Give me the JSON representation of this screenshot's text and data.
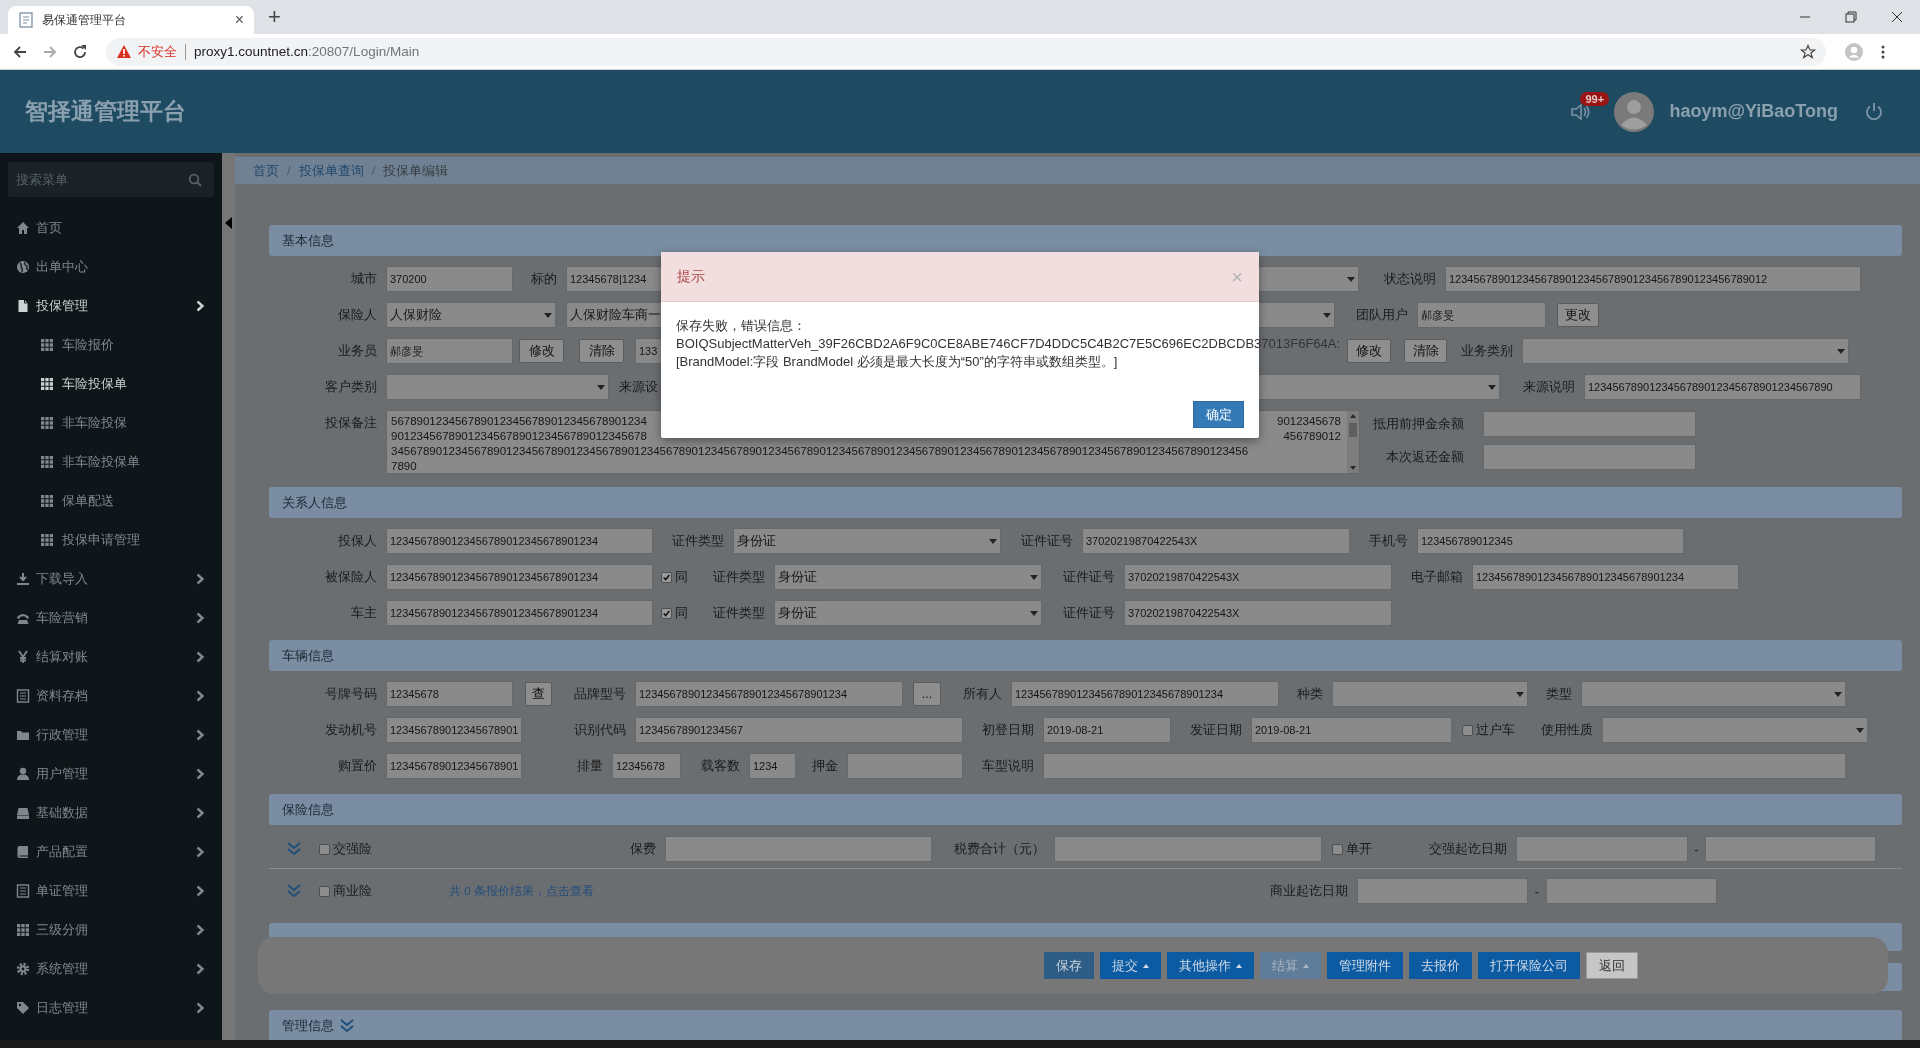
{
  "browser": {
    "tab_title": "易保通管理平台",
    "tab_close": "×",
    "new_tab": "+",
    "security": "不安全",
    "url_host": "proxy1.countnet.cn",
    "url_path": ":20807/Login/Main"
  },
  "header": {
    "title": "智择通管理平台",
    "badge": "99+",
    "user": "haoym@YiBaoTong"
  },
  "sidebar": {
    "search": {
      "placeholder": "搜索菜单"
    },
    "items": [
      {
        "label": "首页",
        "kind": "link",
        "selected": false
      },
      {
        "label": "出单中心",
        "kind": "link",
        "selected": false
      },
      {
        "label": "投保管理",
        "kind": "group",
        "selected": false,
        "expanded": true,
        "children": [
          {
            "label": "车险报价",
            "selected": false
          },
          {
            "label": "车险投保单",
            "selected": true
          },
          {
            "label": "非车险投保",
            "selected": false
          },
          {
            "label": "非车险投保单",
            "selected": false
          },
          {
            "label": "保单配送",
            "selected": false
          },
          {
            "label": "投保申请管理",
            "selected": false
          }
        ]
      },
      {
        "label": "下载导入",
        "kind": "group",
        "selected": false,
        "expanded": false
      },
      {
        "label": "车险营销",
        "kind": "group",
        "selected": false,
        "expanded": false
      },
      {
        "label": "结算对账",
        "kind": "group",
        "selected": false,
        "expanded": false
      },
      {
        "label": "资料存档",
        "kind": "group",
        "selected": false,
        "expanded": false
      },
      {
        "label": "行政管理",
        "kind": "group",
        "selected": false,
        "expanded": false
      },
      {
        "label": "用户管理",
        "kind": "group",
        "selected": false,
        "expanded": false
      },
      {
        "label": "基础数据",
        "kind": "group",
        "selected": false,
        "expanded": false
      },
      {
        "label": "产品配置",
        "kind": "group",
        "selected": false,
        "expanded": false
      },
      {
        "label": "单证管理",
        "kind": "group",
        "selected": false,
        "expanded": false
      },
      {
        "label": "三级分佣",
        "kind": "group",
        "selected": false,
        "expanded": false
      },
      {
        "label": "系统管理",
        "kind": "group",
        "selected": false,
        "expanded": false
      },
      {
        "label": "日志管理",
        "kind": "group",
        "selected": false,
        "expanded": false
      }
    ]
  },
  "breadcrumb": [
    {
      "kind": "link",
      "text": "首页"
    },
    {
      "kind": "separator",
      "text": "/"
    },
    {
      "kind": "link",
      "text": "投保单查询"
    },
    {
      "kind": "separator",
      "text": "/"
    },
    {
      "kind": "current",
      "text": "投保单编辑"
    }
  ],
  "sections": [
    {
      "kind": "form",
      "title": "基本信息",
      "rows": [
        {
          "kind": "fields",
          "items": [
            {
              "kind": "label",
              "text": "城市"
            },
            {
              "kind": "input",
              "value": "370200"
            },
            {
              "kind": "label",
              "text": "标的"
            },
            {
              "kind": "input",
              "value": "12345678|1234"
            },
            {
              "kind": "select"
            },
            {
              "kind": "label",
              "text": "状态说明"
            },
            {
              "kind": "input",
              "value": "1234567890123456789012345678901234567890123456789012"
            }
          ]
        },
        {
          "kind": "fields",
          "items": [
            {
              "kind": "label",
              "text": "保险人"
            },
            {
              "kind": "select",
              "value": "人保财险"
            },
            {
              "kind": "select",
              "value": "人保财险车商一"
            },
            {
              "kind": "label",
              "text": "团队用户"
            },
            {
              "kind": "input",
              "value": "郝彦旻"
            },
            {
              "kind": "button",
              "text": "更改"
            }
          ]
        },
        {
          "kind": "fields",
          "items": [
            {
              "kind": "label",
              "text": "业务员"
            },
            {
              "kind": "input",
              "value": "郝彦旻"
            },
            {
              "kind": "button",
              "text": "修改"
            },
            {
              "kind": "button",
              "text": "清除"
            },
            {
              "kind": "input",
              "value": "133"
            },
            {
              "kind": "button",
              "text": "修改"
            },
            {
              "kind": "button",
              "text": "清除"
            },
            {
              "kind": "label",
              "text": "业务类别"
            },
            {
              "kind": "select"
            }
          ]
        },
        {
          "kind": "fields",
          "items": [
            {
              "kind": "label",
              "text": "客户类别"
            },
            {
              "kind": "select"
            },
            {
              "kind": "label",
              "text": "来源设"
            },
            {
              "kind": "select"
            },
            {
              "kind": "label",
              "text": "来源说明"
            },
            {
              "kind": "input",
              "value": "1234567890123456789012345678901234567890"
            }
          ]
        },
        {
          "kind": "notes",
          "label": "投保备注",
          "lines": [
            {
              "text": "5678901234567890123456789012345678901234",
              "tail": "9012345678"
            },
            {
              "text": "9012345678901234567890123456789012345678",
              "tail": "456789012"
            },
            {
              "text": "34567890123456789012345678901234567890123456789012345678901234567890123456789012345678901234567890123456789012345678901234567890123456"
            },
            {
              "text": "7890"
            }
          ],
          "side": [
            {
              "label": "抵用前押金余额"
            },
            {
              "label": "本次返还金额"
            }
          ]
        }
      ]
    },
    {
      "kind": "form",
      "title": "关系人信息",
      "rows": [
        {
          "kind": "fields",
          "items": [
            {
              "kind": "label",
              "text": "投保人"
            },
            {
              "kind": "input",
              "value": "1234567890123456789012345678901234"
            },
            {
              "kind": "label",
              "text": "证件类型"
            },
            {
              "kind": "select",
              "value": "身份证"
            },
            {
              "kind": "label",
              "text": "证件证号"
            },
            {
              "kind": "input",
              "value": "37020219870422543X"
            },
            {
              "kind": "label",
              "text": "手机号"
            },
            {
              "kind": "input",
              "value": "123456789012345"
            }
          ]
        },
        {
          "kind": "fields",
          "items": [
            {
              "kind": "label",
              "text": "被保险人"
            },
            {
              "kind": "input",
              "value": "1234567890123456789012345678901234"
            },
            {
              "kind": "checkbox",
              "label": "同",
              "checked": true
            },
            {
              "kind": "label",
              "text": "证件类型"
            },
            {
              "kind": "select",
              "value": "身份证"
            },
            {
              "kind": "label",
              "text": "证件证号"
            },
            {
              "kind": "input",
              "value": "37020219870422543X"
            },
            {
              "kind": "label",
              "text": "电子邮箱"
            },
            {
              "kind": "input",
              "value": "1234567890123456789012345678901234"
            }
          ]
        },
        {
          "kind": "fields",
          "items": [
            {
              "kind": "label",
              "text": "车主"
            },
            {
              "kind": "input",
              "value": "1234567890123456789012345678901234"
            },
            {
              "kind": "checkbox",
              "label": "同",
              "checked": true
            },
            {
              "kind": "label",
              "text": "证件类型"
            },
            {
              "kind": "select",
              "value": "身份证"
            },
            {
              "kind": "label",
              "text": "证件证号"
            },
            {
              "kind": "input",
              "value": "37020219870422543X"
            }
          ]
        }
      ]
    },
    {
      "kind": "form",
      "title": "车辆信息",
      "rows": [
        {
          "kind": "fields",
          "items": [
            {
              "kind": "label",
              "text": "号牌号码"
            },
            {
              "kind": "input",
              "value": "12345678"
            },
            {
              "kind": "button",
              "text": "查"
            },
            {
              "kind": "label",
              "text": "品牌型号"
            },
            {
              "kind": "input",
              "value": "1234567890123456789012345678901234"
            },
            {
              "kind": "button",
              "text": "..."
            },
            {
              "kind": "label",
              "text": "所有人"
            },
            {
              "kind": "input",
              "value": "1234567890123456789012345678901234"
            },
            {
              "kind": "label",
              "text": "种类"
            },
            {
              "kind": "select"
            },
            {
              "kind": "label",
              "text": "类型"
            },
            {
              "kind": "select"
            }
          ]
        },
        {
          "kind": "fields",
          "items": [
            {
              "kind": "label",
              "text": "发动机号"
            },
            {
              "kind": "input",
              "value": "123456789012345678901"
            },
            {
              "kind": "label",
              "text": "识别代码"
            },
            {
              "kind": "input",
              "value": "12345678901234567"
            },
            {
              "kind": "label",
              "text": "初登日期"
            },
            {
              "kind": "input",
              "value": "2019-08-21"
            },
            {
              "kind": "label",
              "text": "发证日期"
            },
            {
              "kind": "input",
              "value": "2019-08-21"
            },
            {
              "kind": "checkbox",
              "label": "过户车",
              "checked": false
            },
            {
              "kind": "label",
              "text": "使用性质"
            },
            {
              "kind": "select"
            }
          ]
        },
        {
          "kind": "fields",
          "items": [
            {
              "kind": "label",
              "text": "购置价"
            },
            {
              "kind": "input",
              "value": "123456789012345678901"
            },
            {
              "kind": "label",
              "text": "排量"
            },
            {
              "kind": "input",
              "value": "12345678"
            },
            {
              "kind": "label",
              "text": "载客数"
            },
            {
              "kind": "input",
              "value": "1234"
            },
            {
              "kind": "label",
              "text": "押金"
            },
            {
              "kind": "input"
            },
            {
              "kind": "label",
              "text": "车型说明"
            },
            {
              "kind": "input"
            }
          ]
        }
      ]
    },
    {
      "kind": "form",
      "title": "保险信息",
      "rows": [
        {
          "kind": "fields",
          "items": [
            {
              "kind": "toggle"
            },
            {
              "kind": "checkbox",
              "label": "交强险",
              "checked": false
            },
            {
              "kind": "label",
              "text": "保费"
            },
            {
              "kind": "input"
            },
            {
              "kind": "label",
              "text": "税费合计（元）"
            },
            {
              "kind": "input"
            },
            {
              "kind": "checkbox",
              "label": "单开",
              "checked": false
            },
            {
              "kind": "label",
              "text": "交强起讫日期"
            },
            {
              "kind": "input"
            },
            {
              "kind": "text",
              "text": "-"
            },
            {
              "kind": "input"
            }
          ]
        },
        {
          "kind": "fields",
          "items": [
            {
              "kind": "toggle"
            },
            {
              "kind": "checkbox",
              "label": "商业险",
              "checked": false
            },
            {
              "kind": "link",
              "text": "共 0 条报价结果，点击查看"
            },
            {
              "kind": "label",
              "text": "商业起讫日期"
            },
            {
              "kind": "input"
            },
            {
              "kind": "text",
              "text": "-"
            },
            {
              "kind": "input"
            }
          ]
        }
      ]
    },
    {
      "kind": "covered"
    },
    {
      "kind": "covered"
    },
    {
      "kind": "collapsed",
      "title": "管理信息"
    }
  ],
  "toolbar": {
    "buttons": [
      {
        "label": "保存",
        "kind": "dark",
        "dropdown": false
      },
      {
        "label": "提交",
        "kind": "primary",
        "dropdown": true
      },
      {
        "label": "其他操作",
        "kind": "primary",
        "dropdown": true
      },
      {
        "label": "结算",
        "kind": "muted",
        "dropdown": true
      },
      {
        "label": "管理附件",
        "kind": "primary",
        "dropdown": false
      },
      {
        "label": "去报价",
        "kind": "primary",
        "dropdown": false
      },
      {
        "label": "打开保险公司",
        "kind": "primary",
        "dropdown": false
      },
      {
        "label": "返回",
        "kind": "plain",
        "dropdown": false
      }
    ]
  },
  "dialog": {
    "title": "提示",
    "close": "×",
    "message": "保存失败，错误信息：\nBOIQSubjectMatterVeh_39F26CBD2A6F9C0CE8ABE746CF7D4DDC5C4B2C7E5C696EC2DBCDB37013F6F64A:\n[BrandModel:字段 BrandModel 必须是最大长度为“50”的字符串或数组类型。]",
    "ok": "确定"
  }
}
